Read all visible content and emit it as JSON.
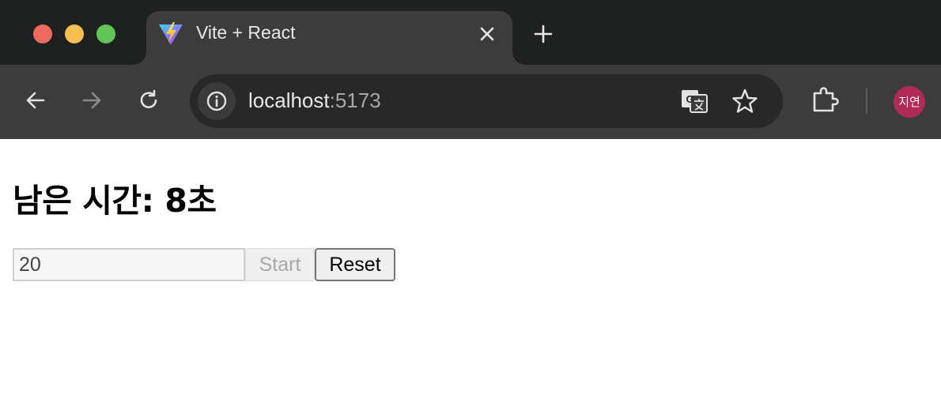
{
  "browser": {
    "tab": {
      "title": "Vite + React",
      "favicon": "vite-logo-icon"
    },
    "address": {
      "host": "localhost",
      "port": ":5173"
    },
    "profile": {
      "initials": "지연",
      "color": "#b02a57"
    }
  },
  "app": {
    "heading": "남은 시간: 8초",
    "seconds_input": {
      "value": "20"
    },
    "start_label": "Start",
    "start_disabled": true,
    "reset_label": "Reset"
  }
}
